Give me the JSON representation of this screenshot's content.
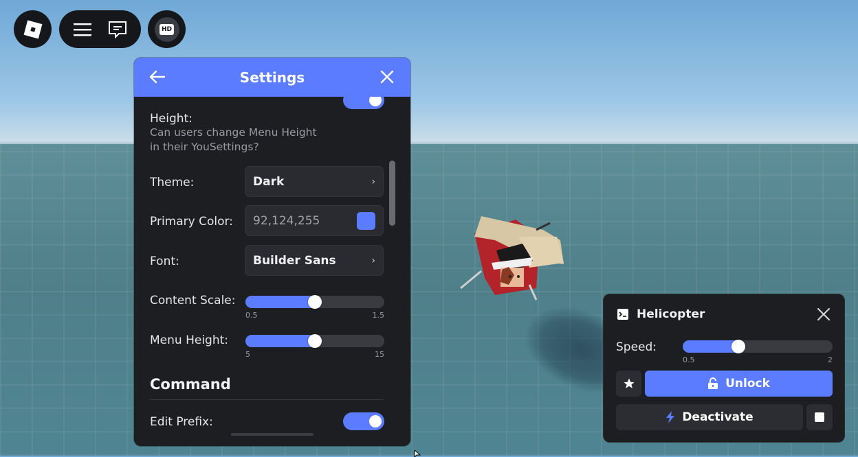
{
  "colors": {
    "accent": "#5c7cff",
    "panel": "#1d1e22",
    "field": "#2a2b30",
    "primary_swatch": "#5c7cff"
  },
  "topbar": {
    "roblox_icon": "roblox-logo-icon",
    "menu_icon": "hamburger-icon",
    "chat_icon": "chat-icon",
    "hd_label": "HD"
  },
  "settings": {
    "title": "Settings",
    "height_label": "Height:",
    "height_desc_line1": "Can users change Menu Height",
    "height_desc_line2": "in their YouSettings?",
    "theme_label": "Theme:",
    "theme_value": "Dark",
    "primary_color_label": "Primary Color:",
    "primary_color_value": "92,124,255",
    "font_label": "Font:",
    "font_value": "Builder Sans",
    "content_scale": {
      "label": "Content Scale:",
      "min": "0.5",
      "max": "1.5",
      "fraction": 0.5
    },
    "menu_height": {
      "label": "Menu Height:",
      "min": "5",
      "max": "15",
      "fraction": 0.5
    },
    "command_section": "Command",
    "edit_prefix_label": "Edit Prefix:"
  },
  "helicopter": {
    "title": "Helicopter",
    "speed_label": "Speed:",
    "speed_min": "0.5",
    "speed_max": "2",
    "speed_fraction": 0.37,
    "unlock_label": "Unlock",
    "deactivate_label": "Deactivate"
  }
}
